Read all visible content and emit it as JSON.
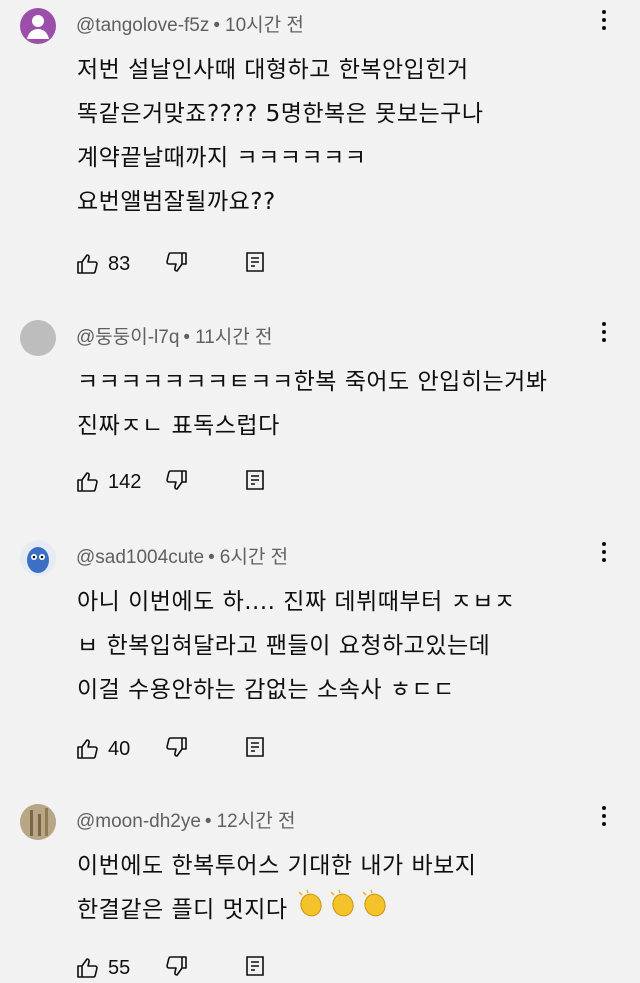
{
  "comments": [
    {
      "username": "@tangolove-f5z",
      "time": "10시간 전",
      "avatar_color": "#9b4fa8",
      "lines": [
        "저번 설날인사때 대형하고 한복안입힌거",
        "똑같은거맞죠???? 5명한복은 못보는구나",
        "계약끝날때까지 ㅋㅋㅋㅋㅋㅋ",
        "요번앨범잘될까요??"
      ],
      "likes": "83"
    },
    {
      "username": "@둥둥이-l7q",
      "time": "11시간 전",
      "avatar_color": "#bdbdbd",
      "lines": [
        "ㅋㅋㅋㅋㅋㅋㅋㅌㅋㅋ한복 죽어도 안입히는거봐",
        "진짜ㅈㄴ 표독스럽다"
      ],
      "likes": "142"
    },
    {
      "username": "@sad1004cute",
      "time": "6시간 전",
      "avatar_color": "#3a6fc4",
      "lines": [
        "아니 이번에도 하....  진짜 데뷔때부터 ㅈㅂㅈ",
        "ㅂ 한복입혀달라고 팬들이 요청하고있는데",
        "이걸 수용안하는 감없는 소속사 ㅎㄷㄷ"
      ],
      "likes": "40"
    },
    {
      "username": "@moon-dh2ye",
      "time": "12시간 전",
      "avatar_color": "#8a7a5c",
      "lines": [
        "이번에도 한복투어스 기대한 내가 바보지",
        "한결같은 플디 멋지다"
      ],
      "likes": "55"
    }
  ],
  "icons": {
    "like": "thumbs-up-icon",
    "dislike": "thumbs-down-icon",
    "reply": "reply-icon",
    "menu": "more-vert-icon",
    "emoji": "clapping-hands-icon"
  }
}
